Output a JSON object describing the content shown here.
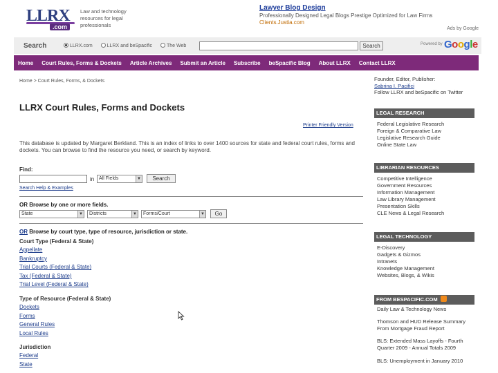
{
  "header": {
    "logo_text": "LLRX",
    "logo_sub": ".com",
    "tagline": "Law and technology resources for legal professionals",
    "ad": {
      "title": "Lawyer Blog Design",
      "description": "Professionally Designed Legal Blogs Prestige Optimized for Law Firms",
      "url": "Clients.Justia.com"
    },
    "ads_by": "Ads by Google"
  },
  "search": {
    "label": "Search",
    "options": [
      "LLRX.com",
      "LLRX and beSpacific",
      "The Web"
    ],
    "selected": 0,
    "value": "",
    "button": "Search",
    "powered_by": "Powered by",
    "google": [
      "G",
      "o",
      "o",
      "g",
      "l",
      "e"
    ]
  },
  "nav": [
    "Home",
    "Court Rules, Forms & Dockets",
    "Article Archives",
    "Submit an Article",
    "Subscribe",
    "beSpacific Blog",
    "About LLRX",
    "Contact LLRX"
  ],
  "main": {
    "breadcrumb": "Home > Court Rules, Forms, & Dockets",
    "title": "LLRX Court Rules, Forms and Dockets",
    "printer_friendly": "Printer Friendly Version",
    "intro": "This database is updated by Margaret Berkland. This is an index of links to over 1400 sources for state and federal court rules, forms and dockets. You can browse to find the resource you need, or search by keyword.",
    "find_label": "Find:",
    "find_value": "",
    "in_label": "in",
    "in_select": "All Fields",
    "search_button": "Search",
    "search_help": "Search Help & Examples",
    "browse_fields_heading": "OR Browse by one or more fields.",
    "field_selects": [
      "State",
      "Districts",
      "Forms/Court"
    ],
    "go_button": "Go",
    "browse_type_prefix": "OR",
    "browse_type_heading": " Browse by court type, type of resource, jurisdiction or state.",
    "court_type": {
      "heading": "Court Type (Federal & State)",
      "items": [
        "Appellate",
        "Bankruptcy",
        "Trial Courts (Federal & State)",
        "Tax (Federal & State)",
        "Trial Level (Federal & State)"
      ]
    },
    "resource_type": {
      "heading": "Type of Resource (Federal & State)",
      "items": [
        "Dockets",
        "Forms",
        "General Rules",
        "Local Rules"
      ]
    },
    "jurisdiction": {
      "heading": "Jurisdiction",
      "items": [
        "Federal",
        "State"
      ]
    }
  },
  "sidebar": {
    "top_lines": [
      "Founder, Editor, Publisher:",
      "Sabrina I. Pacifici",
      "Follow LLRX and beSpacific on Twitter"
    ],
    "sections": [
      {
        "title": "Legal Research",
        "items": [
          "Federal Legislative Research",
          "Foreign & Comparative Law",
          "Legislative Research Guide",
          "Online State Law"
        ]
      },
      {
        "title": "Librarian Resources",
        "items": [
          "Competitive Intelligence",
          "Government Resources",
          "Information Management",
          "Law Library Management",
          "Presentation Skills",
          "CLE News & Legal Research"
        ]
      },
      {
        "title": "Legal Technology",
        "items": [
          "E-Discovery",
          "Gadgets & Gizmos",
          "Intranets",
          "Knowledge Management",
          "Websites, Blogs, & Wikis"
        ]
      }
    ],
    "bespacific": {
      "title": "From beSpacific.com",
      "subtitle": "Daily Law & Technology News",
      "news": [
        "Thomson and HUD Release Summary From Mortgage Fraud Report",
        "BLS: Extended Mass Layoffs - Fourth Quarter 2009 - Annual Totals 2009",
        "BLS: Unemployment in January 2010"
      ]
    }
  },
  "colors": {
    "nav_bg": "#7e2a7a",
    "section_header_bg": "#5c5c5c",
    "link": "#1a3a8a",
    "ad_url": "#c06a00"
  }
}
